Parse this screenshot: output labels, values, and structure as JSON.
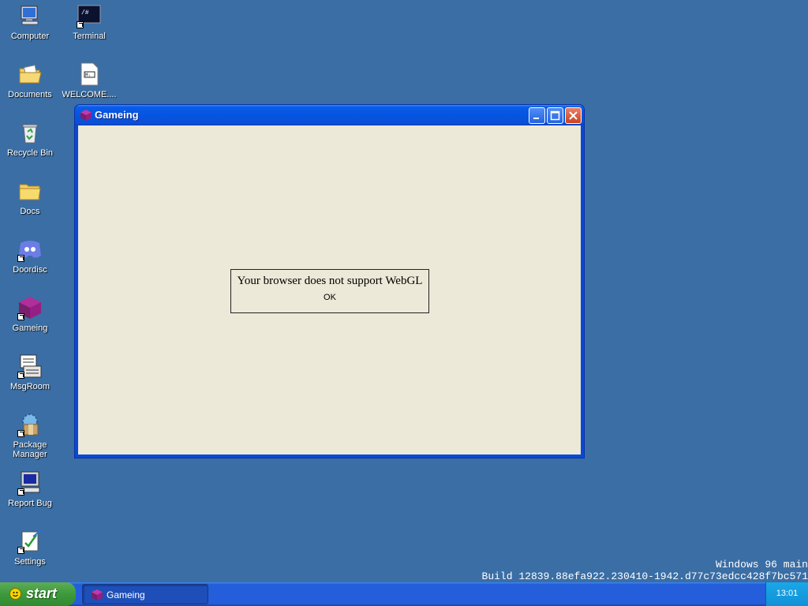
{
  "desktop": {
    "icons": [
      {
        "label": "Computer"
      },
      {
        "label": "Terminal"
      },
      {
        "label": "Documents"
      },
      {
        "label": "WELCOME...."
      },
      {
        "label": "Recycle Bin"
      },
      {
        "label": "Docs"
      },
      {
        "label": "Doordisc"
      },
      {
        "label": "Gameing"
      },
      {
        "label": "MsgRoom"
      },
      {
        "label": "Package Manager"
      },
      {
        "label": "Report Bug"
      },
      {
        "label": "Settings"
      }
    ]
  },
  "window": {
    "title": "Gameing",
    "alert": {
      "message": "Your browser does not support WebGL",
      "ok_label": "OK"
    }
  },
  "watermark": {
    "line1": "Windows 96 main",
    "line2": "Build 12839.88efa922.230410-1942.d77c73edcc428f7bc571"
  },
  "taskbar": {
    "start_label": "start",
    "tasks": [
      {
        "label": "Gameing"
      }
    ],
    "clock": "13:01"
  },
  "colors": {
    "desktop": "#3a6ea5",
    "titlebar": "#0a5ce8",
    "window_client": "#ece9d8",
    "start_button": "#3c9a3c",
    "taskbar": "#245edb",
    "tray": "#1aa7e8"
  }
}
